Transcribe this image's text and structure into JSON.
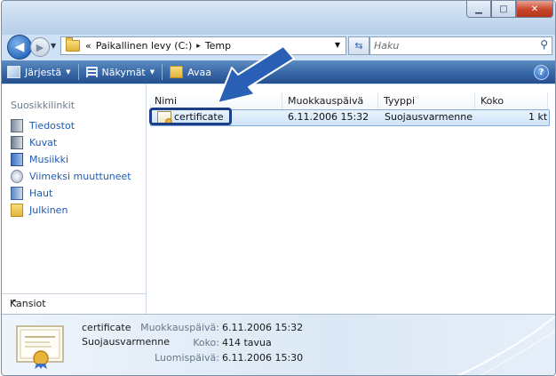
{
  "address_bar": {
    "overflow": "«",
    "segments": [
      "Paikallinen levy (C:)",
      "Temp"
    ],
    "separator": "▸"
  },
  "search": {
    "placeholder": "Haku"
  },
  "toolbar": {
    "organize": "Järjestä",
    "views": "Näkymät",
    "open": "Avaa"
  },
  "nav_pane": {
    "title": "Suosikkilinkit",
    "items": [
      {
        "label": "Tiedostot",
        "icon": "documents-icon"
      },
      {
        "label": "Kuvat",
        "icon": "pictures-icon"
      },
      {
        "label": "Musiikki",
        "icon": "music-icon"
      },
      {
        "label": "Viimeksi muuttuneet",
        "icon": "recent-icon"
      },
      {
        "label": "Haut",
        "icon": "searches-icon"
      },
      {
        "label": "Julkinen",
        "icon": "public-folder-icon"
      }
    ],
    "footer": "Kansiot"
  },
  "file_list": {
    "columns": [
      "Nimi",
      "Muokkauspäivä",
      "Tyyppi",
      "Koko"
    ],
    "rows": [
      {
        "name": "certificate",
        "modified": "6.11.2006 15:32",
        "type": "Suojausvarmenne",
        "size": "1 kt"
      }
    ]
  },
  "details": {
    "name": "certificate",
    "type": "Suojausvarmenne",
    "modified_label": "Muokkauspäivä:",
    "modified_value": "6.11.2006 15:32",
    "size_label": "Koko:",
    "size_value": "414 tavua",
    "created_label": "Luomispäivä:",
    "created_value": "6.11.2006 15:30"
  },
  "colors": {
    "toolbar": "#3a6aa8",
    "link": "#1f5bb4",
    "selection": "#cfe4fa",
    "annotation": "#1d3f87"
  }
}
